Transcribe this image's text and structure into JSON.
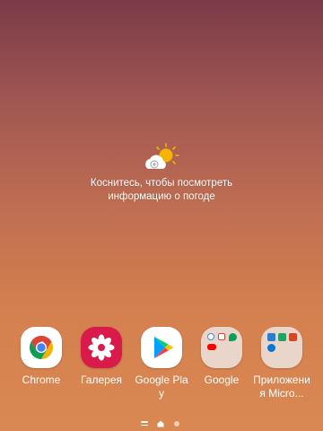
{
  "weather": {
    "icon": "partly-sunny-add-icon",
    "line1": "Коснитесь, чтобы посмотреть",
    "line2": "информацию о погоде"
  },
  "apps": [
    {
      "label": "Chrome",
      "icon": "chrome-icon"
    },
    {
      "label": "Галерея",
      "icon": "gallery-flower-icon"
    },
    {
      "label": "Google Play",
      "icon": "play-store-icon"
    },
    {
      "label": "Google",
      "icon": "google-folder-icon"
    },
    {
      "label": "Приложения Micro...",
      "icon": "microsoft-folder-icon"
    }
  ],
  "pager": {
    "pages": [
      "menu",
      "home",
      "page-2"
    ],
    "active": "home"
  },
  "colors": {
    "gallery_bg": "#d81b4a",
    "chrome_red": "#db4437",
    "chrome_green": "#0f9d58",
    "chrome_yellow": "#f4b400",
    "chrome_blue": "#4285f4"
  }
}
